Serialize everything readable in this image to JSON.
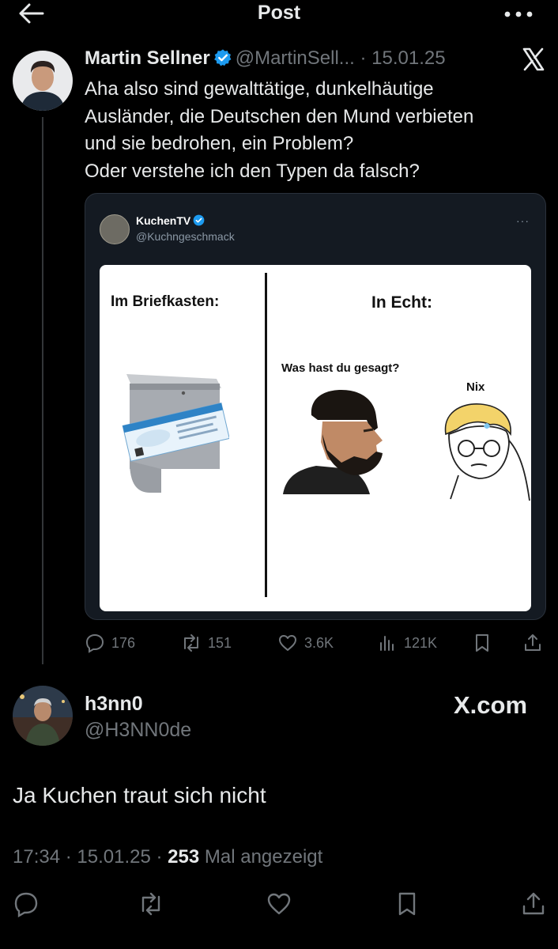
{
  "topbar": {
    "title": "Post",
    "back_icon": "arrow-left-icon",
    "more_icon": "more-horizontal-icon"
  },
  "tweet1": {
    "author_name": "Martin Sellner",
    "handle": "@MartinSell...",
    "separator": "·",
    "date": "15.01.25",
    "verified": true,
    "lines": [
      "Aha also sind gewalttätige, dunkelhäutige",
      "Ausländer, die Deutschen den Mund verbieten",
      "und sie bedrohen, ein Problem?",
      "Oder verstehe ich den Typen da falsch?"
    ],
    "quote": {
      "author_name": "KuchenTV",
      "handle": "@Kuchngeschmack",
      "more": "···",
      "meme": {
        "left_title": "Im Briefkasten:",
        "right_title": "In Echt:",
        "speech": "Was hast du gesagt?",
        "reply": "Nix"
      }
    },
    "stats": {
      "replies": "176",
      "reposts": "151",
      "likes": "3.6K",
      "views": "121K"
    }
  },
  "tweet2": {
    "author_name": "h3nn0",
    "handle": "@H3NN0de",
    "brand": "X.com",
    "text": "Ja Kuchen traut sich nicht",
    "time": "17:34",
    "date": "15.01.25",
    "views_count": "253",
    "views_label": "Mal angezeigt"
  },
  "colors": {
    "background": "#000000",
    "text": "#e7e9ea",
    "muted": "#71767b",
    "verified": "#1d9bf0"
  }
}
